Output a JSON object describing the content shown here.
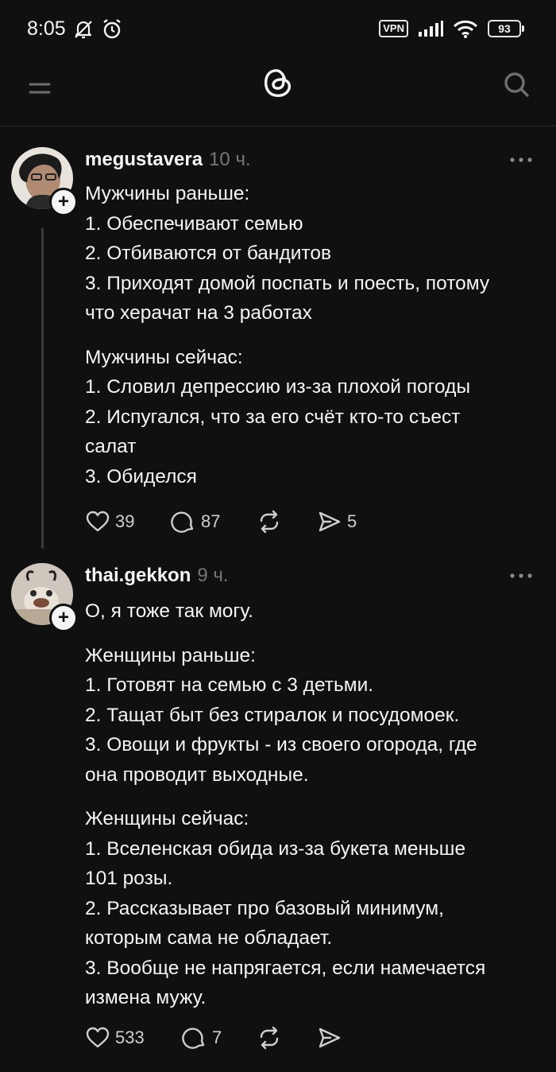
{
  "status_bar": {
    "time": "8:05",
    "vpn": "VPN",
    "battery": "93",
    "icons": [
      "notifications-muted-icon",
      "alarm-icon",
      "signal-icon",
      "wifi-icon",
      "battery-icon"
    ]
  },
  "header": {
    "icons": [
      "menu-icon",
      "threads-logo-icon",
      "search-icon"
    ]
  },
  "posts": [
    {
      "username": "megustavera",
      "time": "10 ч.",
      "lines_a": [
        "Мужчины раньше:",
        "1. Обеспечивают семью",
        "2. Отбиваются от бандитов",
        "3. Приходят домой поспать и поесть, потому",
        "что херачат на 3 работах"
      ],
      "lines_b": [
        "Мужчины сейчас:",
        "1. Словил депрессию из-за плохой погоды",
        "2. Испугался, что за его счёт кто-то съест",
        "салат",
        "3. Обиделся"
      ],
      "likes": "39",
      "comments": "87",
      "shares": "5"
    },
    {
      "username": "thai.gekkon",
      "time": "9 ч.",
      "lines_a": [
        "О, я тоже так могу."
      ],
      "lines_b": [
        "Женщины раньше:",
        "1. Готовят на семью с 3 детьми.",
        "2. Тащат быт без стиралок и посудомоек.",
        "3. Овощи и фрукты - из своего огорода, где",
        "она проводит выходные."
      ],
      "lines_c": [
        "Женщины сейчас:",
        "1. Вселенская обида из-за букета меньше",
        "101 розы.",
        "2. Рассказывает про базовый минимум,",
        "которым сама не обладает.",
        "3. Вообще не напрягается, если намечается",
        "измена мужу."
      ],
      "likes": "533",
      "comments": "7"
    }
  ],
  "colors": {
    "background": "#101010",
    "text": "#f3f5f7",
    "muted": "#777777"
  }
}
